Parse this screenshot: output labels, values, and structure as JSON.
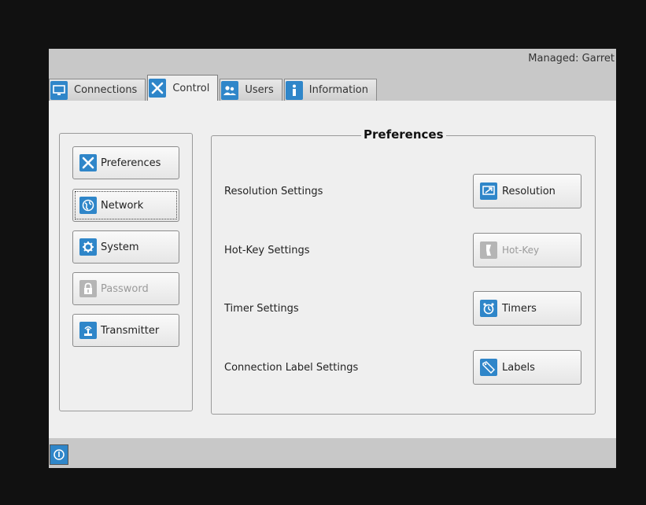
{
  "header": {
    "managed_text": "Managed: Garret"
  },
  "tabs": [
    {
      "label": "Connections",
      "icon": "monitor-icon",
      "active": false
    },
    {
      "label": "Control",
      "icon": "tools-icon",
      "active": true
    },
    {
      "label": "Users",
      "icon": "users-icon",
      "active": false
    },
    {
      "label": "Information",
      "icon": "info-icon",
      "active": false
    }
  ],
  "sidebar": {
    "items": [
      {
        "label": "Preferences",
        "icon": "tools-icon"
      },
      {
        "label": "Network",
        "icon": "globe-icon",
        "focused": true
      },
      {
        "label": "System",
        "icon": "gear-icon"
      },
      {
        "label": "Password",
        "icon": "lock-icon",
        "disabled": true
      },
      {
        "label": "Transmitter",
        "icon": "antenna-icon"
      }
    ]
  },
  "preferences": {
    "title": "Preferences",
    "rows": [
      {
        "label": "Resolution Settings",
        "button": "Resolution",
        "icon": "resolution-icon"
      },
      {
        "label": "Hot-Key Settings",
        "button": "Hot-Key",
        "icon": "hotkey-icon",
        "disabled": true
      },
      {
        "label": "Timer Settings",
        "button": "Timers",
        "icon": "timer-icon"
      },
      {
        "label": "Connection Label Settings",
        "button": "Labels",
        "icon": "tag-icon"
      }
    ]
  },
  "colors": {
    "accent": "#2f86c9",
    "panel_bg": "#efefef",
    "bar_bg": "#c8c8c8"
  }
}
